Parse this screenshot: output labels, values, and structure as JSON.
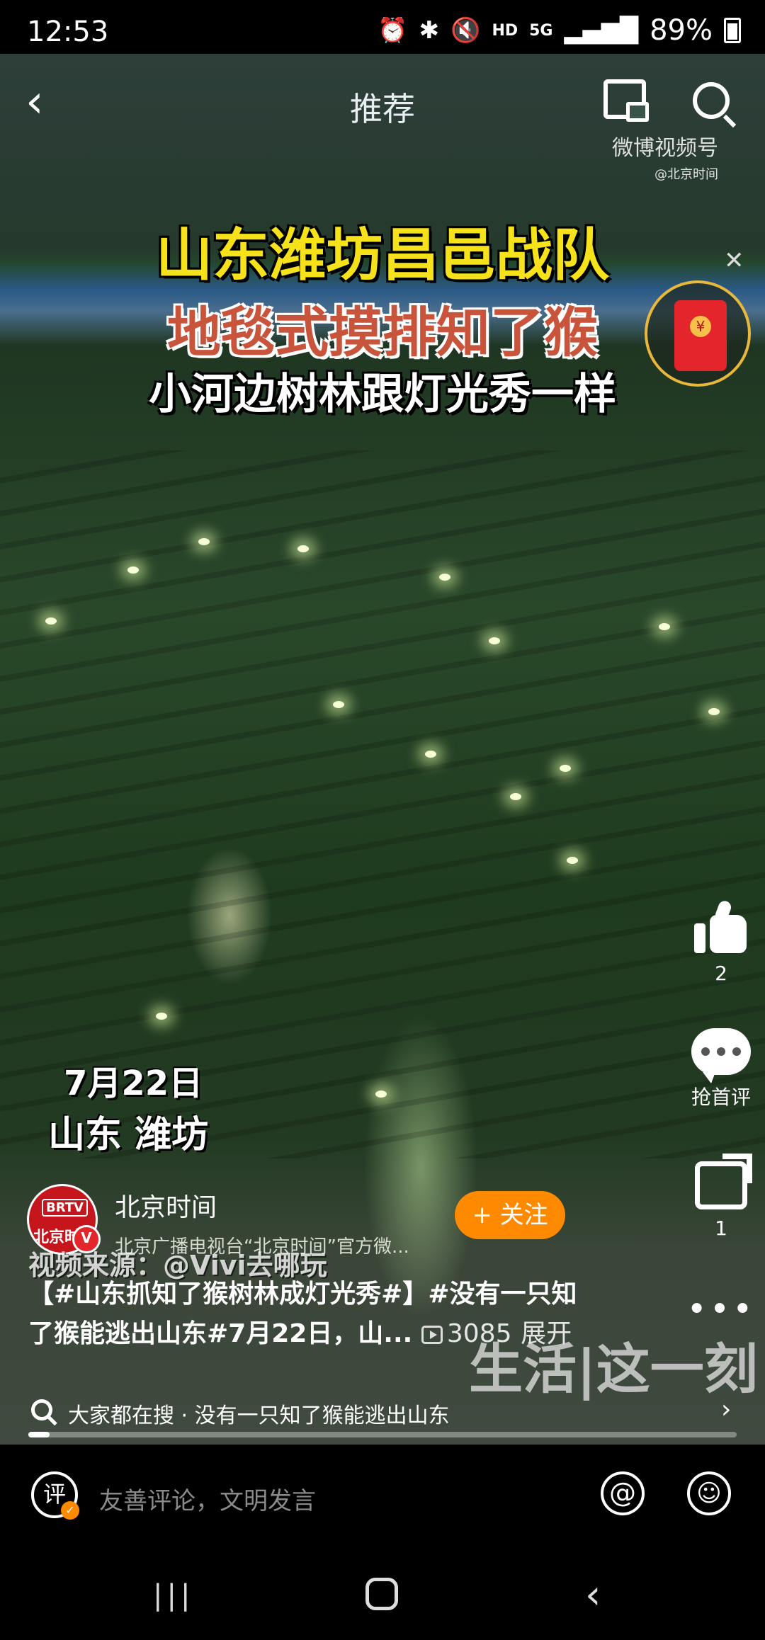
{
  "status_bar": {
    "time": "12:53",
    "indicators": [
      "alarm-icon",
      "bluetooth-icon",
      "mute-icon",
      "HD",
      "5G",
      "signal-icon"
    ],
    "hd": "HD",
    "network": "5G",
    "battery": "89%"
  },
  "top_bar": {
    "title": "推荐",
    "watermark_brand": "微博视频号",
    "watermark_account": "@北京时间"
  },
  "video": {
    "headline_1": "山东潍坊昌邑战队",
    "headline_2": "地毯式摸排知了猴",
    "headline_3": "小河边树林跟灯光秀一样",
    "date_overlay_1": "7月22日",
    "date_overlay_2": "山东 潍坊",
    "source_overlay": "视频来源：@Vivi去哪玩",
    "watermark_bottom": "生活|这一刻"
  },
  "right_rail": {
    "like_count": "2",
    "comment_label": "抢首评",
    "share_count": "1",
    "more": "•••"
  },
  "publisher": {
    "avatar_badge": "BRTV",
    "avatar_text": "北京时间",
    "verified": "V",
    "name": "北京时间",
    "description": "北京广播电视台“北京时间”官方微...",
    "follow_label": "+ 关注"
  },
  "post": {
    "text": "【#山东抓知了猴树林成灯光秀#】#没有一只知了猴能逃出山东#7月22日，山...",
    "views": "3085",
    "expand": "展开"
  },
  "search_bar": {
    "text": "大家都在搜 · 没有一只知了猴能逃出山东",
    "chevron": "›"
  },
  "progress": {
    "played_fraction": 0.03
  },
  "comment_bar": {
    "icon_text": "评",
    "placeholder": "友善评论，文明发言",
    "at_symbol": "@",
    "emoji": "☺"
  },
  "nav_bar": {
    "recent": "|||",
    "back": "‹"
  }
}
